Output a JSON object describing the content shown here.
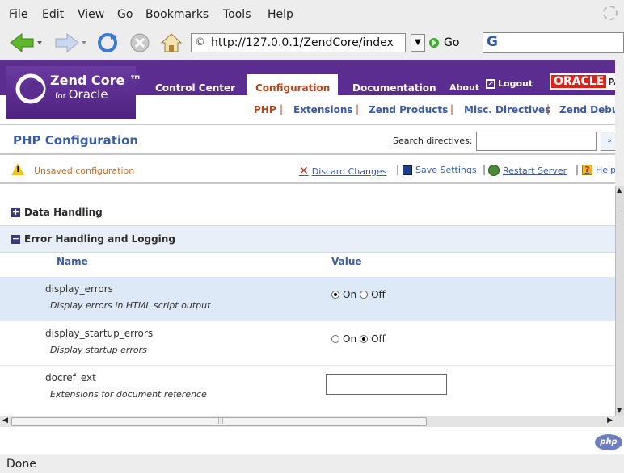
{
  "browser": {
    "menu": [
      "File",
      "Edit",
      "View",
      "Go",
      "Bookmarks",
      "Tools",
      "Help"
    ],
    "url": "http://127.0.0.1/ZendCore/index",
    "go_label": "Go",
    "status": "Done"
  },
  "header": {
    "logo_line1": "Zend Core ™",
    "logo_for": "for",
    "logo_line2": "Oracle",
    "tabs": [
      "Control Center",
      "Configuration",
      "Documentation"
    ],
    "about": "About",
    "logout": "Logout",
    "oracle": "ORACLE",
    "oracle_rest": "PA",
    "subtabs": [
      "PHP",
      "Extensions",
      "Zend Products",
      "Misc. Directives",
      "Zend Debugg"
    ]
  },
  "page": {
    "title": "PHP Configuration",
    "search_label": "Search directives:",
    "search_value": "",
    "search_button": "»"
  },
  "actions": {
    "unsaved": "Unsaved configuration",
    "discard": "Discard Changes",
    "save": "Save Settings",
    "restart": "Restart Server",
    "help": "Help"
  },
  "sections": [
    {
      "label": "Data Handling",
      "expanded": false
    },
    {
      "label": "Error Handling and Logging",
      "expanded": true
    }
  ],
  "columns": {
    "name": "Name",
    "value": "Value"
  },
  "directives": [
    {
      "name": "display_errors",
      "desc": "Display errors in HTML script output",
      "on": "On",
      "off": "Off",
      "selected": "On"
    },
    {
      "name": "display_startup_errors",
      "desc": "Display startup errors",
      "on": "On",
      "off": "Off",
      "selected": "Off"
    },
    {
      "name": "docref_ext",
      "desc": "Extensions for document reference",
      "value": ""
    }
  ],
  "footer_badge": "php",
  "colors": {
    "brand_purple": "#5c2d91",
    "link_blue": "#3a5ca8",
    "active_orange": "#b8461c",
    "highlight": "#dde9f7"
  }
}
